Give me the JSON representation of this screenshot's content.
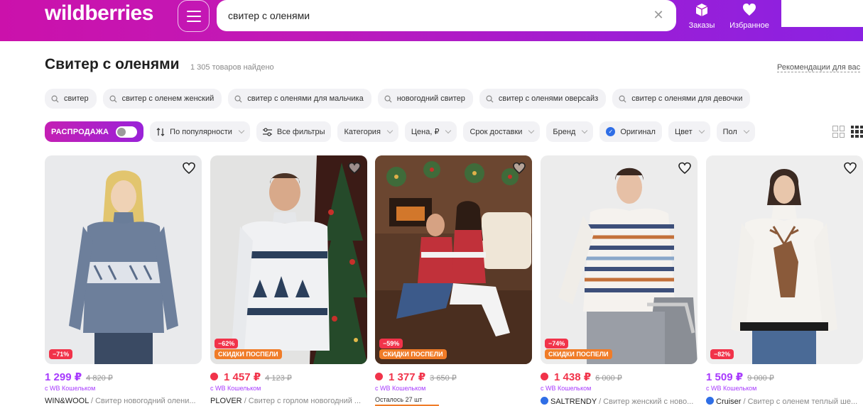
{
  "header": {
    "logo": "wildberries",
    "search_value": "свитер с оленями",
    "orders_label": "Заказы",
    "favorites_label": "Избранное",
    "gradient": [
      "#cb11ab",
      "#8a22e2"
    ]
  },
  "page": {
    "title": "Свитер с оленями",
    "count": "1 305 товаров найдено",
    "recommendations": "Рекомендации для вас"
  },
  "chips": [
    "свитер",
    "свитер с оленем женский",
    "свитер с оленями для мальчика",
    "новогодний свитер",
    "свитер с оленями оверсайз",
    "свитер с оленями для девочки"
  ],
  "filters": {
    "sale": "РАСПРОДАЖА",
    "sort": "По популярности",
    "all": "Все фильтры",
    "category": "Категория",
    "price": "Цена, ₽",
    "delivery": "Срок доставки",
    "brand": "Бренд",
    "original": "Оригинал",
    "color": "Цвет",
    "gender": "Пол"
  },
  "products": [
    {
      "discount": "−71%",
      "promo": "",
      "price": "1 299 ₽",
      "old_price": "4 820 ₽",
      "wallet": "с WB Кошельком",
      "brand": "WIN&WOOL",
      "desc": " / Свитер новогодний олени..."
    },
    {
      "discount": "−62%",
      "promo": "СКИДКИ ПОСПЕЛИ",
      "price": "1 457 ₽",
      "old_price": "4 123 ₽",
      "wallet": "с WB Кошельком",
      "brand": "PLOVER",
      "desc": " / Свитер с горлом новогодний ..."
    },
    {
      "discount": "−59%",
      "promo": "СКИДКИ ПОСПЕЛИ",
      "price": "1 377 ₽",
      "old_price": "3 650 ₽",
      "wallet": "с WB Кошельком",
      "left": "Осталось 27 шт"
    },
    {
      "discount": "−74%",
      "promo": "СКИДКИ ПОСПЕЛИ",
      "price": "1 438 ₽",
      "old_price": "6 000 ₽",
      "wallet": "с WB Кошельком",
      "brand": "SALTRENDY",
      "desc": " / Свитер женский с ново..."
    },
    {
      "discount": "−82%",
      "promo": "",
      "price": "1 509 ₽",
      "old_price": "9 000 ₽",
      "wallet": "с WB Кошельком",
      "brand": "Cruiser",
      "desc": " / Свитер с оленем теплый ше..."
    }
  ]
}
